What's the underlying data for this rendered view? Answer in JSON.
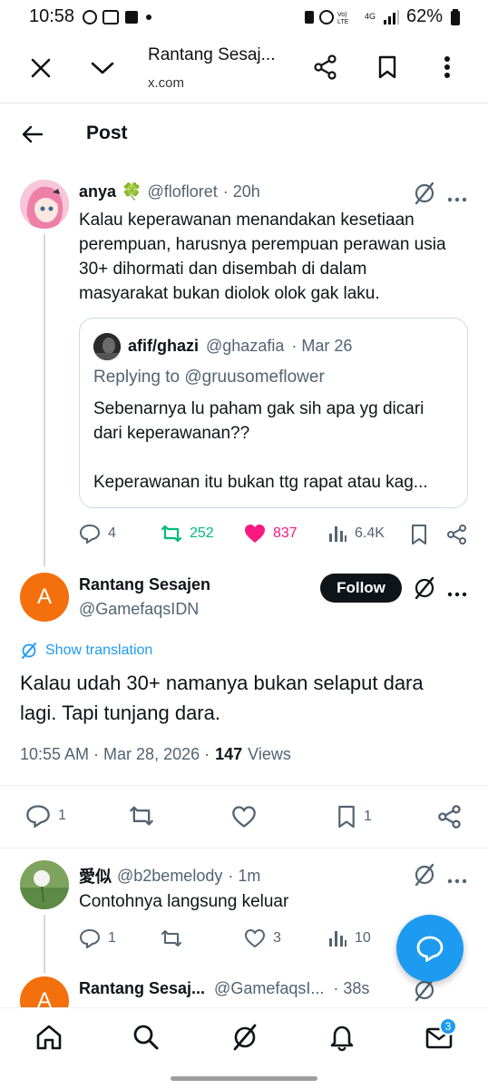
{
  "status_bar": {
    "time": "10:58",
    "battery": "62%",
    "network": "4G",
    "volte": "Vo) LTE"
  },
  "browser": {
    "title": "Rantang Sesaj...",
    "url": "x.com"
  },
  "header": {
    "title": "Post"
  },
  "parent_tweet": {
    "display_name": "anya",
    "emoji": "🍀",
    "handle": "@flofloret",
    "time": "· 20h",
    "text_lines": [
      "Kalau keperawanan menandakan kesetiaan",
      "perempuan, harusnya perempuan perawan usia",
      "30+ dihormati dan disembah di dalam",
      "masyarakat bukan diolok olok gak laku."
    ],
    "quote": {
      "display_name": "afif/ghazi",
      "handle": "@ghazafia",
      "time": "· Mar 26",
      "replying_prefix": "Replying to",
      "replying_to": "@gruusomeflower",
      "text_lines": [
        "Sebenarnya lu paham gak sih apa yg dicari",
        "dari keperawanan??",
        "",
        "Keperawanan itu bukan ttg rapat atau kag..."
      ]
    },
    "replies": "4",
    "reposts": "252",
    "likes": "837",
    "views": "6.4K"
  },
  "main_tweet": {
    "display_name": "Rantang Sesajen",
    "handle": "@GamefaqsIDN",
    "avatar_letter": "A",
    "follow_label": "Follow",
    "show_translation": "Show translation",
    "text_lines": [
      "Kalau udah 30+ namanya bukan selaput dara",
      "lagi. Tapi tunjang dara."
    ],
    "timestamp": "10:55 AM · Mar 28, 2026 ·",
    "views_count": "147",
    "views_label": "Views",
    "replies": "1",
    "bookmarks": "1"
  },
  "reply_tweet": {
    "display_name": "愛似",
    "handle": "@b2bemelody",
    "time": "· 1m",
    "text": "Contohnya langsung keluar",
    "replies": "1",
    "likes": "3",
    "views": "10"
  },
  "next_tweet": {
    "display_name": "Rantang Sesaj...",
    "handle": "@GamefaqsI...",
    "time": "· 38s",
    "avatar_letter": "A"
  },
  "bottom_nav": {
    "messages_badge": "3"
  },
  "colors": {
    "like_pink": "#f91880",
    "repost_green": "#00ba7c",
    "link_blue": "#1d9bf0",
    "avatar_orange": "#f4700c"
  }
}
